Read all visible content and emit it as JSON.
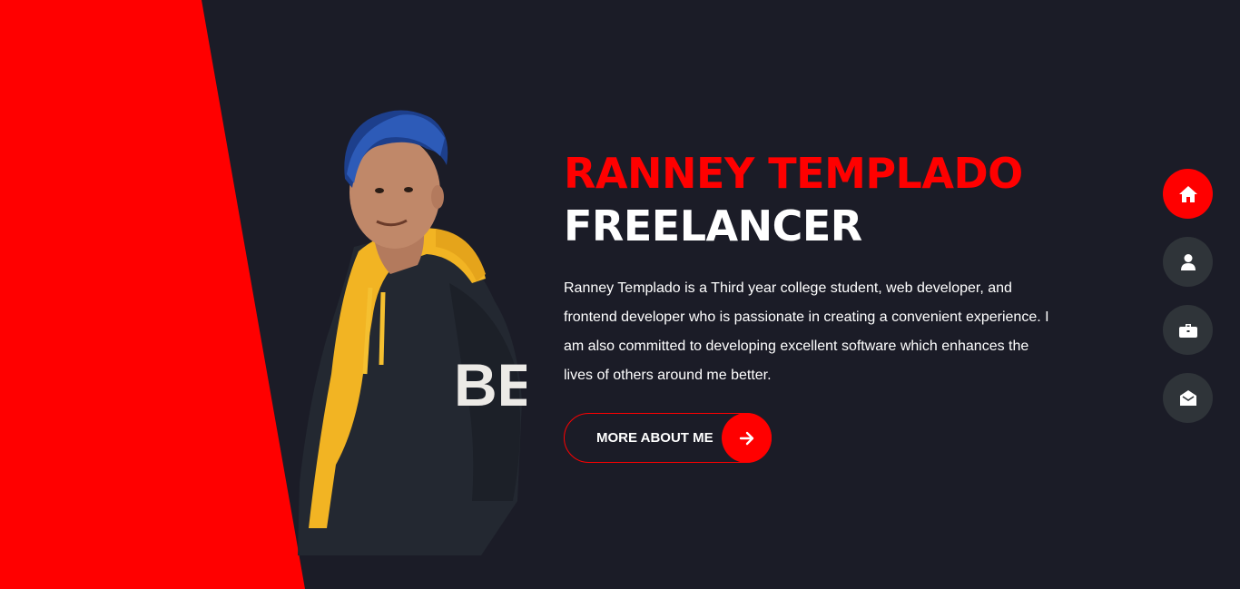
{
  "hero": {
    "name": "RANNEY TEMPLADO",
    "role": "FREELANCER",
    "bio": "Ranney Templado is a Third year college student, web developer, and frontend developer who is passionate in creating a convenient experience. I am also committed to developing excellent software which enhances the lives of others around me better.",
    "cta_label": "MORE ABOUT ME",
    "cta_icon": "arrow-right-icon"
  },
  "photo": {
    "shirt_text": "BE"
  },
  "nav": {
    "items": [
      {
        "icon": "home-icon",
        "active": true
      },
      {
        "icon": "user-icon",
        "active": false
      },
      {
        "icon": "briefcase-icon",
        "active": false
      },
      {
        "icon": "envelope-open-icon",
        "active": false
      }
    ]
  },
  "colors": {
    "background": "#1b1c27",
    "accent": "#ff0000",
    "nav_inactive": "#2f3439",
    "text": "#ffffff"
  }
}
